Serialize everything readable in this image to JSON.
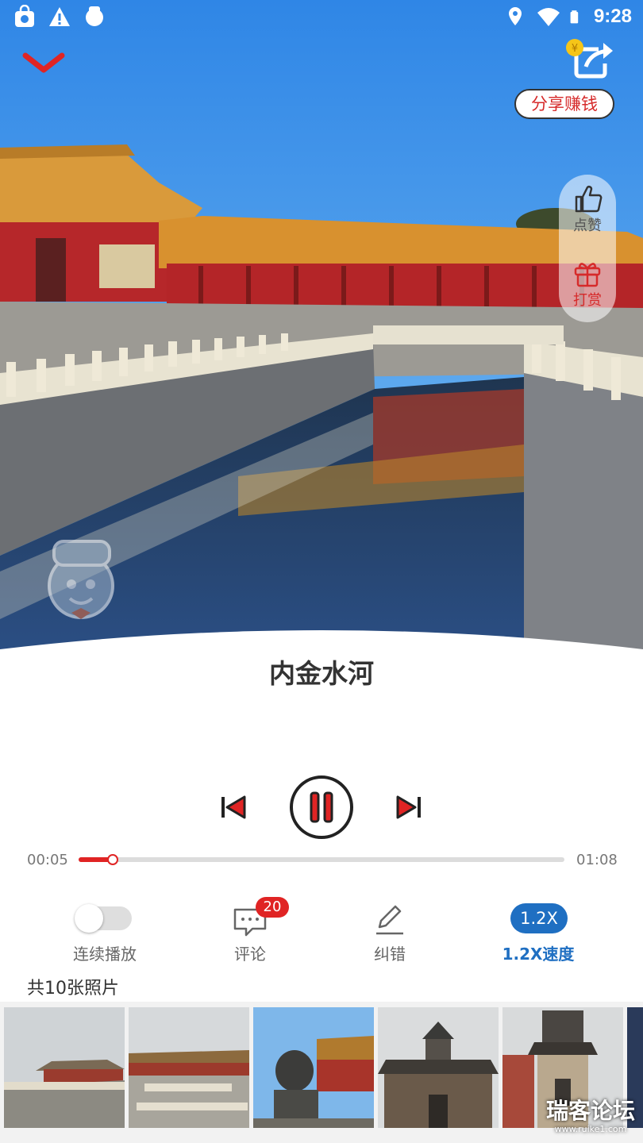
{
  "status_bar": {
    "time": "9:28",
    "left_icons": [
      "store-icon",
      "warning-icon",
      "mascot-icon"
    ],
    "right_icons": [
      "location-icon",
      "wifi-icon",
      "battery-icon"
    ]
  },
  "header": {
    "collapse_icon": "chevron-down-icon",
    "share_icon": "share-coin-icon",
    "share_label": "分享赚钱"
  },
  "side_actions": [
    {
      "label": "点赞",
      "icon": "thumbs-up-icon"
    },
    {
      "label": "打赏",
      "icon": "gift-icon"
    }
  ],
  "track": {
    "title": "内金水河",
    "current_time": "00:05",
    "total_time": "01:08",
    "progress": 0.07,
    "state": "playing"
  },
  "actions": {
    "continuous": {
      "label": "连续播放",
      "enabled": false
    },
    "comment": {
      "label": "评论",
      "count": "20"
    },
    "correct": {
      "label": "纠错"
    },
    "speed": {
      "label": "1.2X速度",
      "value": "1.2X"
    }
  },
  "photos": {
    "count_label": "共10张照片",
    "thumbnails": [
      "photo-1",
      "photo-2",
      "photo-3",
      "photo-4",
      "photo-5"
    ]
  },
  "watermark": {
    "name": "瑞客论坛",
    "url": "www.ruike1.com"
  },
  "colors": {
    "accent_red": "#e02424",
    "speed_blue": "#1f6fc2"
  }
}
